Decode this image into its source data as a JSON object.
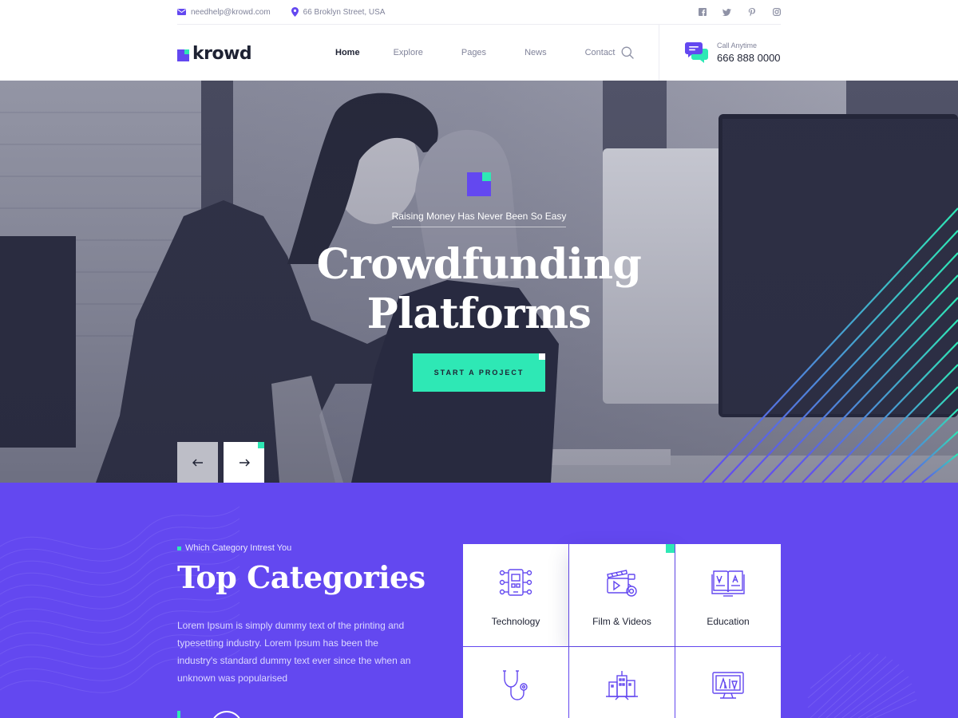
{
  "topbar": {
    "email": "needhelp@krowd.com",
    "address": "66 Broklyn Street, USA",
    "socials": [
      "facebook-icon",
      "twitter-icon",
      "pinterest-icon",
      "instagram-icon"
    ]
  },
  "header": {
    "logo_text": "krowd",
    "nav": [
      "Home",
      "Explore",
      "Pages",
      "News",
      "Contact"
    ],
    "active_nav": "Home",
    "call_label": "Call Anytime",
    "call_number": "666 888 0000"
  },
  "hero": {
    "tagline": "Raising Money Has Never Been So Easy",
    "title_line1": "Crowdfunding",
    "title_line2": "Platforms",
    "cta_label": "START A PROJECT",
    "prev_icon": "arrow-left-icon",
    "next_icon": "arrow-right-icon"
  },
  "categories": {
    "subtitle": "Which Category Intrest You",
    "title": "Top Categories",
    "description": "Lorem Ipsum is simply dummy text of the printing and typesetting industry. Lorem Ipsum has been the industry's standard dummy text ever since the when an unknown was popularised",
    "items": [
      {
        "label": "Technology",
        "icon": "technology-icon"
      },
      {
        "label": "Film & Videos",
        "icon": "film-camera-icon"
      },
      {
        "label": "Education",
        "icon": "book-icon"
      },
      {
        "label": "",
        "icon": "stethoscope-icon"
      },
      {
        "label": "",
        "icon": "city-buildings-icon"
      },
      {
        "label": "",
        "icon": "monitor-design-icon"
      }
    ]
  },
  "colors": {
    "brand": "#6348f0",
    "accent": "#2ee8b5",
    "dark": "#1e2233",
    "muted": "#80839a"
  }
}
